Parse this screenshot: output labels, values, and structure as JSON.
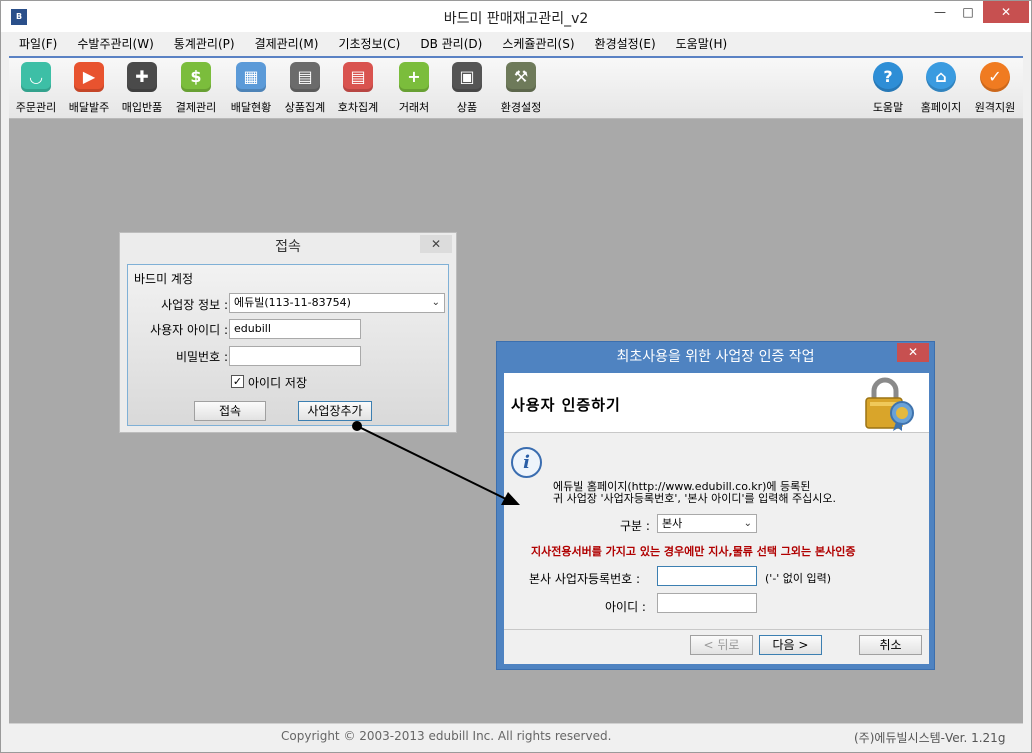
{
  "window": {
    "title": "바드미 판매재고관리_v2",
    "icon_text": "B"
  },
  "window_controls": {
    "minimize": "—",
    "maximize": "□",
    "close": "✕"
  },
  "menu": [
    "파일(F)",
    "수발주관리(W)",
    "통계관리(P)",
    "결제관리(M)",
    "기초정보(C)",
    "DB 관리(D)",
    "스케쥴관리(S)",
    "환경설정(E)",
    "도움말(H)"
  ],
  "toolbar": {
    "left": [
      {
        "label": "주문관리",
        "icon": "basket-icon",
        "glyph": "◡",
        "color": "#3dbfa6"
      },
      {
        "label": "배달발주",
        "icon": "truck-icon",
        "glyph": "▶",
        "color": "#e8532f"
      },
      {
        "label": "매입반품",
        "icon": "cart-return-icon",
        "glyph": "✚",
        "color": "#4a4a4a"
      },
      {
        "label": "결제관리",
        "icon": "payment-icon",
        "glyph": "$",
        "color": "#7bbd3c"
      },
      {
        "label": "배달현황",
        "icon": "calendar-icon",
        "glyph": "▦",
        "color": "#5b9ad8"
      },
      {
        "label": "상품집계",
        "icon": "product-summary-icon",
        "glyph": "▤",
        "color": "#6b6b6b"
      },
      {
        "label": "호차집계",
        "icon": "vehicle-summary-icon",
        "glyph": "▤",
        "color": "#d9534f"
      },
      {
        "label": "거래처",
        "icon": "client-add-icon",
        "glyph": "+",
        "color": "#7bbd3c"
      },
      {
        "label": "상품",
        "icon": "boxes-icon",
        "glyph": "▣",
        "color": "#555555"
      },
      {
        "label": "환경설정",
        "icon": "wrench-icon",
        "glyph": "⚒",
        "color": "#6e7a5a"
      }
    ],
    "right": [
      {
        "label": "도움말",
        "icon": "help-icon",
        "glyph": "?",
        "color": "#2e8ed6"
      },
      {
        "label": "홈페이지",
        "icon": "home-icon",
        "glyph": "⌂",
        "color": "#3a9be0"
      },
      {
        "label": "원격지원",
        "icon": "remote-support-icon",
        "glyph": "✓",
        "color": "#f07b21"
      }
    ]
  },
  "status": {
    "copyright": "Copyright © 2003-2013 edubill Inc. All rights reserved.",
    "version": "(주)에듀빌시스템-Ver. 1.21g"
  },
  "login_dialog": {
    "title": "접속",
    "close": "✕",
    "group_title": "바드미 계정",
    "site_label": "사업장 정보 :",
    "site_value": "에듀빌(113-11-83754)",
    "user_label": "사용자 아이디 :",
    "user_value": "edubill",
    "password_label": "비밀번호 :",
    "password_value": "",
    "remember_label": "아이디 저장",
    "remember_checked": "✓",
    "connect_button": "접속",
    "add_site_button": "사업장추가"
  },
  "wizard": {
    "title": "최초사용을 위한 사업장 인증 작업",
    "close": "✕",
    "heading": "사용자 인증하기",
    "info_glyph": "i",
    "instruction_line1": "에듀빌 홈페이지(http://www.edubill.co.kr)에 등록된",
    "instruction_line2": "귀 사업장 '사업자등록번호', '본사 아이디'를 입력해 주십시오.",
    "type_label": "구분 :",
    "type_value": "본사",
    "warning": "지사전용서버를 가지고 있는 경우에만 지사,물류 선택 그외는 본사인증",
    "bizno_label": "본사 사업자등록번호 :",
    "bizno_value": "",
    "bizno_hint": "('-' 없이 입력)",
    "id_label": "아이디 :",
    "id_value": "",
    "back_button": "< 뒤로",
    "next_button": "다음 >",
    "cancel_button": "취소"
  },
  "colors": {
    "workspace": "#a9a9a9",
    "wizard_frame": "#4f83c1",
    "close_red": "#c75050",
    "warning_red": "#b00000"
  }
}
